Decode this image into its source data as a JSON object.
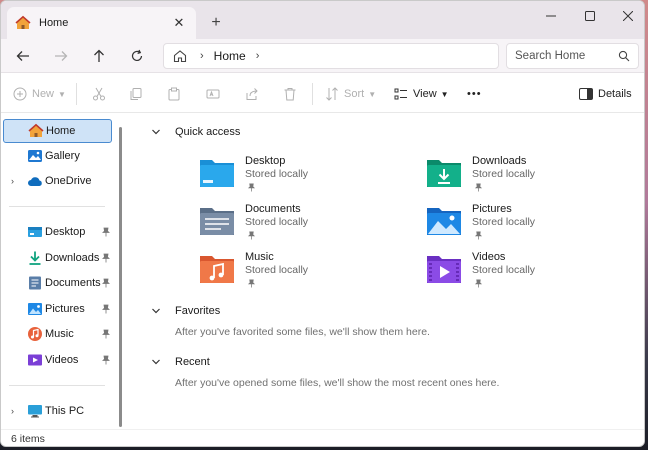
{
  "tab": {
    "title": "Home",
    "close": "✕",
    "new_tab": "+"
  },
  "window_controls": {
    "minimize": "—",
    "maximize": "☐",
    "close": "✕"
  },
  "address": {
    "crumb": "Home",
    "search_placeholder": "Search Home"
  },
  "toolbar": {
    "new_label": "New",
    "sort_label": "Sort",
    "view_label": "View",
    "more_label": "•••",
    "details_label": "Details"
  },
  "sidebar": {
    "top_items": [
      {
        "label": "Home",
        "icon": "home-icon",
        "selected": true
      },
      {
        "label": "Gallery",
        "icon": "gallery-icon"
      },
      {
        "label": "OneDrive",
        "icon": "cloud-icon",
        "expandable": true
      }
    ],
    "pinned_items": [
      {
        "label": "Desktop",
        "icon": "desktop-icon"
      },
      {
        "label": "Downloads",
        "icon": "downloads-icon"
      },
      {
        "label": "Documents",
        "icon": "documents-icon"
      },
      {
        "label": "Pictures",
        "icon": "pictures-icon"
      },
      {
        "label": "Music",
        "icon": "music-icon"
      },
      {
        "label": "Videos",
        "icon": "videos-icon"
      }
    ],
    "bottom_items": [
      {
        "label": "This PC",
        "icon": "pc-icon",
        "expandable": true
      }
    ]
  },
  "main": {
    "quick_access": {
      "title": "Quick access",
      "tiles": [
        {
          "name": "Desktop",
          "sub": "Stored locally",
          "icon": "desktop-folder-icon"
        },
        {
          "name": "Downloads",
          "sub": "Stored locally",
          "icon": "downloads-folder-icon"
        },
        {
          "name": "Documents",
          "sub": "Stored locally",
          "icon": "documents-folder-icon"
        },
        {
          "name": "Pictures",
          "sub": "Stored locally",
          "icon": "pictures-folder-icon"
        },
        {
          "name": "Music",
          "sub": "Stored locally",
          "icon": "music-folder-icon"
        },
        {
          "name": "Videos",
          "sub": "Stored locally",
          "icon": "videos-folder-icon"
        }
      ]
    },
    "favorites": {
      "title": "Favorites",
      "message": "After you've favorited some files, we'll show them here."
    },
    "recent": {
      "title": "Recent",
      "message": "After you've opened some files, we'll show the most recent ones here."
    }
  },
  "status": {
    "items": "6 items"
  },
  "colors": {
    "accent": "#0067c0",
    "selection_bg": "#cfe3f7",
    "selection_border": "#4a8bd0"
  }
}
